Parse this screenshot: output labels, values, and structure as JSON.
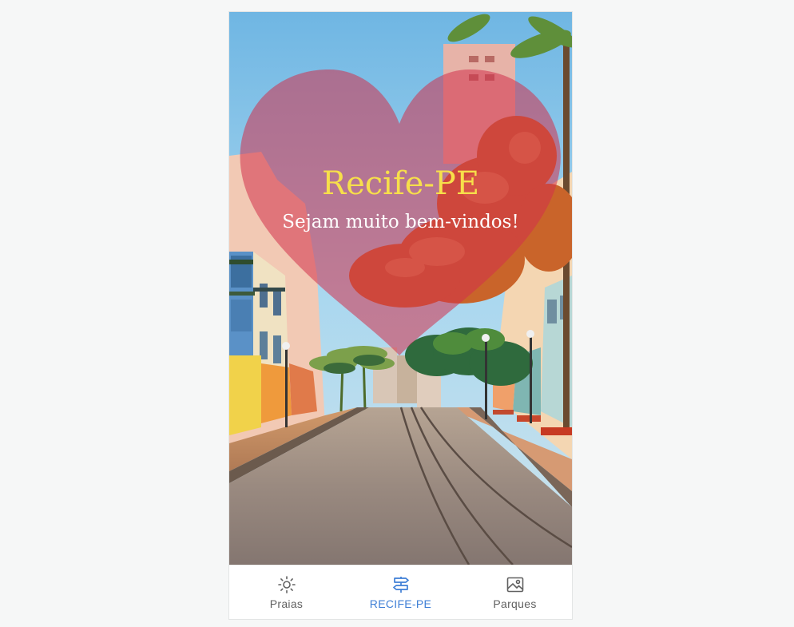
{
  "hero": {
    "title": "Recife-PE",
    "subtitle": "Sejam muito bem-vindos!",
    "colors": {
      "title": "#f7df4a",
      "subtitle": "#ffffff",
      "heart": "#d2304a"
    }
  },
  "bottom_nav": {
    "items": [
      {
        "label": "Praias",
        "icon": "sun-icon",
        "active": false
      },
      {
        "label": "RECIFE-PE",
        "icon": "signpost-icon",
        "active": true
      },
      {
        "label": "Parques",
        "icon": "image-icon",
        "active": false
      }
    ],
    "colors": {
      "active": "#3f7fd6",
      "inactive": "#616161"
    }
  }
}
